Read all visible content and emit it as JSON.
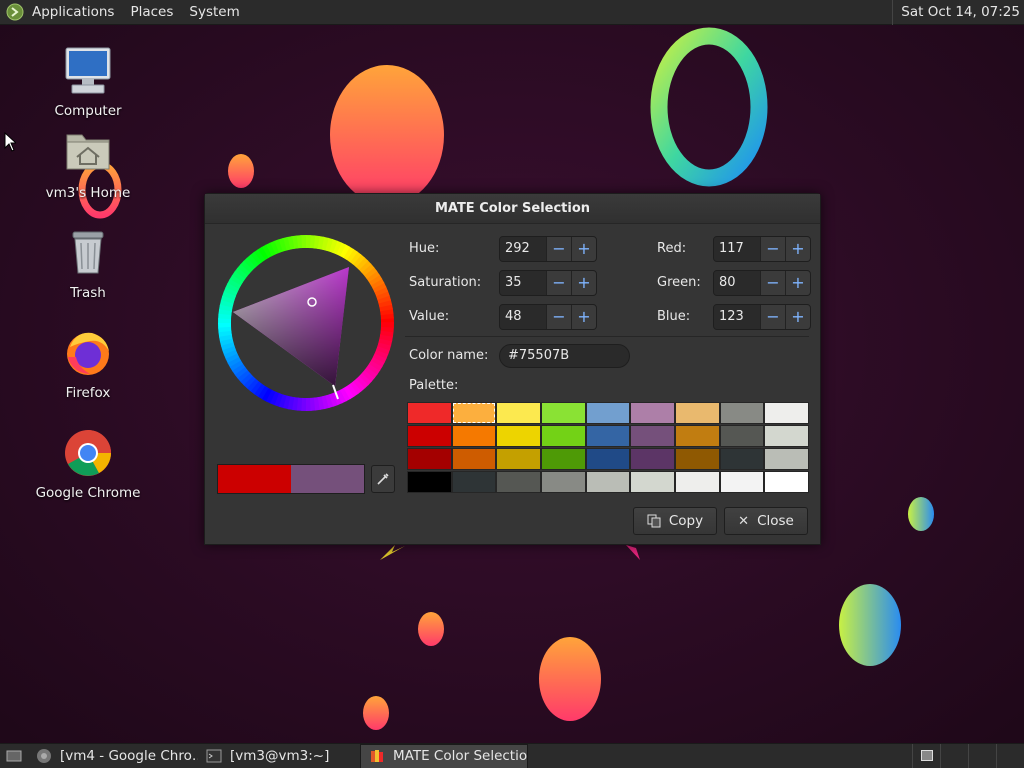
{
  "top_panel": {
    "menus": [
      "Applications",
      "Places",
      "System"
    ],
    "clock": "Sat Oct 14, 07:25"
  },
  "desktop_icons": [
    {
      "label": "Computer",
      "icon": "computer-icon"
    },
    {
      "label": "vm3's Home",
      "icon": "home-folder-icon"
    },
    {
      "label": "Trash",
      "icon": "trash-icon"
    },
    {
      "label": "Firefox",
      "icon": "firefox-icon"
    },
    {
      "label": "Google Chrome",
      "icon": "chrome-icon"
    }
  ],
  "dialog": {
    "title": "MATE Color Selection",
    "hue_label": "Hue:",
    "hue": "292",
    "saturation_label": "Saturation:",
    "saturation": "35",
    "value_label": "Value:",
    "value": "48",
    "red_label": "Red:",
    "red": "117",
    "green_label": "Green:",
    "green": "80",
    "blue_label": "Blue:",
    "blue": "123",
    "color_name_label": "Color name:",
    "color_name": "#75507B",
    "palette_label": "Palette:",
    "palette": [
      [
        "#ef2929",
        "#fcaf3e",
        "#fce94f",
        "#8ae234",
        "#729fcf",
        "#ad7fa8",
        "#e9b96e",
        "#888a85",
        "#eeeeec"
      ],
      [
        "#cc0000",
        "#f57900",
        "#edd400",
        "#73d216",
        "#3465a4",
        "#75507b",
        "#c17d11",
        "#555753",
        "#d3d7cf"
      ],
      [
        "#a40000",
        "#ce5c00",
        "#c4a000",
        "#4e9a06",
        "#204a87",
        "#5c3566",
        "#8f5902",
        "#2e3436",
        "#babdb6"
      ],
      [
        "#000000",
        "#2e3436",
        "#555753",
        "#888a85",
        "#babdb6",
        "#d3d7cf",
        "#eeeeec",
        "#f3f3f3",
        "#ffffff"
      ]
    ],
    "current_color": "#cc0000",
    "previous_color": "#75507b",
    "copy_label": "Copy",
    "close_label": "Close"
  },
  "taskbar": {
    "tasks": [
      {
        "label": "[vm4 - Google Chro…",
        "icon": "chrome-icon",
        "active": false
      },
      {
        "label": "[vm3@vm3:~]",
        "icon": "terminal-icon",
        "active": false
      },
      {
        "label": "MATE Color Selection",
        "icon": "color-selection-icon",
        "active": true
      }
    ]
  },
  "colors": {
    "panel_bg": "#2b2b2b",
    "dialog_bg": "#353535",
    "accent_blue": "#7fb4ff"
  }
}
